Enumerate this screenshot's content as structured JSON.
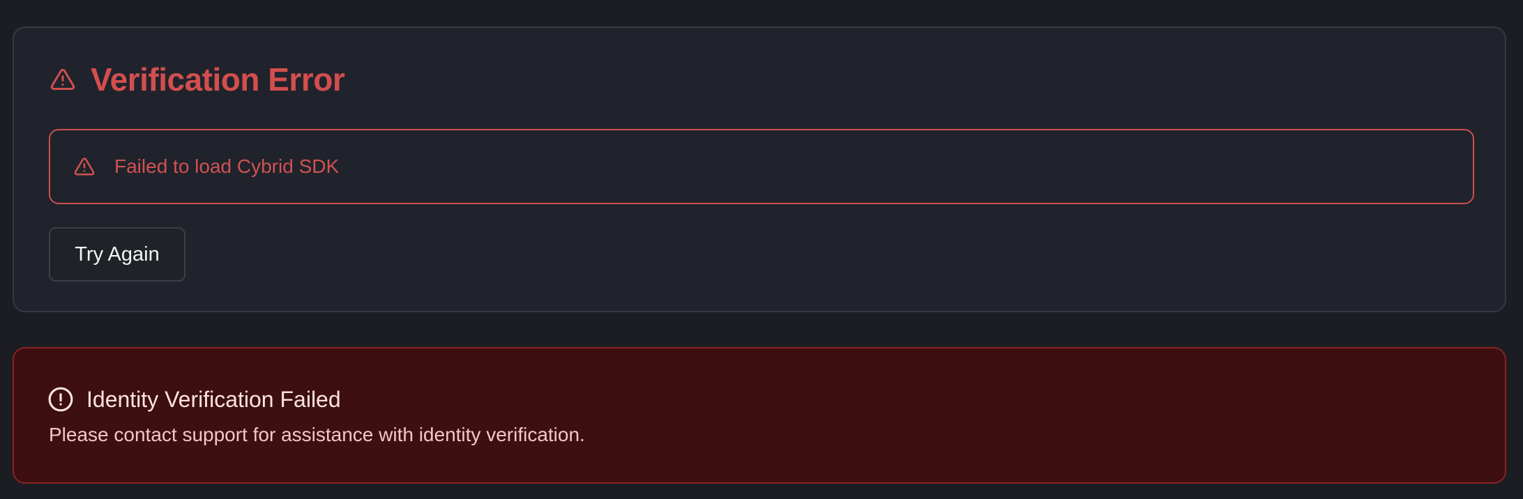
{
  "verification_card": {
    "title": "Verification Error",
    "title_icon": "warning-triangle-icon",
    "alert": {
      "icon": "warning-triangle-icon",
      "message": "Failed to load Cybrid SDK"
    },
    "retry_button_label": "Try Again"
  },
  "failure_notice": {
    "icon": "alert-circle-icon",
    "heading": "Identity Verification Failed",
    "message": "Please contact support for assistance with identity verification."
  },
  "colors": {
    "page_background": "#1b1d22",
    "card_background": "#20232b",
    "error_red": "#d24f4f",
    "failure_background": "#3d0f0f",
    "failure_border": "#8a2323"
  }
}
